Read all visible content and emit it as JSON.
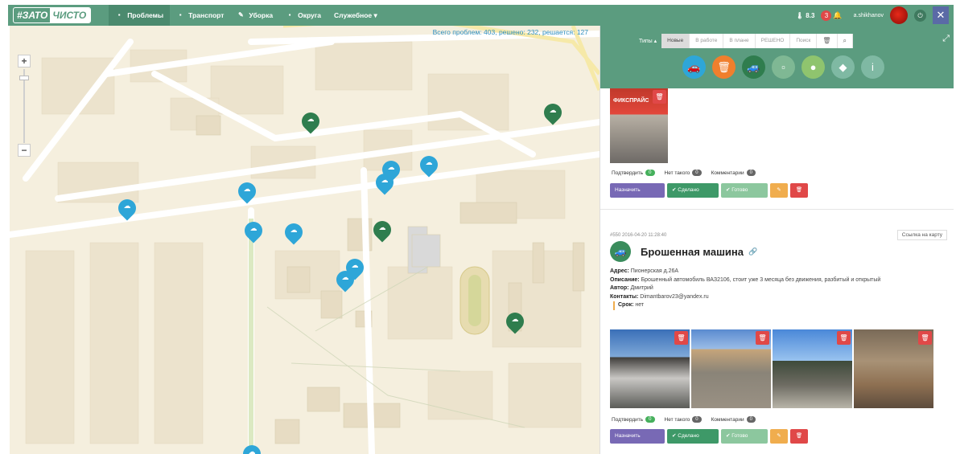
{
  "navbar": {
    "logo_left": "#ЗАТО",
    "logo_right": "ЧИСТО",
    "items": [
      {
        "label": "Проблемы",
        "icon": "list-icon",
        "glyph": "▪",
        "active": true
      },
      {
        "label": "Транспорт",
        "icon": "bus-icon",
        "glyph": "▪",
        "active": false
      },
      {
        "label": "Уборка",
        "icon": "broom-icon",
        "glyph": "✎",
        "active": false
      },
      {
        "label": "Округа",
        "icon": "district-icon",
        "glyph": "▪",
        "active": false
      },
      {
        "label": "Служебное ▾",
        "icon": "",
        "glyph": "",
        "active": false
      }
    ],
    "rating": "8.3 ",
    "notifications": "3",
    "username": "a.shikhanov"
  },
  "map": {
    "summary": "Всего проблем: 403, решено: 232, решается: 127",
    "zoom_in": "+",
    "zoom_out": "−",
    "markers": [
      {
        "kind": "green",
        "glyph": "☁"
      },
      {
        "kind": "green",
        "glyph": "☁"
      },
      {
        "kind": "blue",
        "glyph": "☁"
      },
      {
        "kind": "blue",
        "glyph": "☁"
      },
      {
        "kind": "blue",
        "glyph": "☁"
      },
      {
        "kind": "blue",
        "glyph": "☁"
      },
      {
        "kind": "blue",
        "glyph": "☁"
      },
      {
        "kind": "blue",
        "glyph": "☁"
      },
      {
        "kind": "blue",
        "glyph": "☁"
      },
      {
        "kind": "blue",
        "glyph": "☁"
      },
      {
        "kind": "green",
        "glyph": "☁"
      },
      {
        "kind": "blue",
        "glyph": "☁"
      },
      {
        "kind": "green",
        "glyph": "☁"
      },
      {
        "kind": "blue",
        "glyph": "☁"
      }
    ]
  },
  "panel": {
    "types_toggle": "Типы ▴",
    "tabs": [
      "Новые",
      "В работе",
      "В плане",
      "РЕШЕНО",
      "Поиск"
    ],
    "trash_glyph": "🗑",
    "search_glyph": "⌕",
    "expand_glyph": "⤢",
    "categories": [
      {
        "name": "car-icon",
        "glyph": "🚗",
        "color": "#2ea6d8"
      },
      {
        "name": "trash-icon",
        "glyph": "🗑",
        "color": "#f07f2d"
      },
      {
        "name": "abandoned-car-icon",
        "glyph": "🚙",
        "color": "#2f7d4e"
      },
      {
        "name": "bus-stop-icon",
        "glyph": "▫",
        "color": "#7fb894"
      },
      {
        "name": "tree-icon",
        "glyph": "●",
        "color": "#8fc46e"
      },
      {
        "name": "road-icon",
        "glyph": "◆",
        "color": "#7fb9a3"
      },
      {
        "name": "sign-icon",
        "glyph": "i",
        "color": "#7fb9a3"
      }
    ],
    "card1": {
      "shop_sign": "ФИКСПРАЙС",
      "confirm_label": "Подтвердить",
      "confirm_count": "0",
      "not_exist_label": "Нет такого",
      "not_exist_count": "0",
      "comments_label": "Комментарии",
      "comments_count": "0",
      "btn_assign": "Назначить",
      "btn_solved": "✔ Сделано",
      "btn_done": "✔ Готово",
      "btn_edit": "✎",
      "btn_delete": "🗑"
    },
    "post": {
      "meta": "#550 2016-04-20 11:28:40",
      "map_link": "Ссылка на карту",
      "title": "Брошенная машина",
      "link_glyph": "🔗",
      "address_label": "Адрес:",
      "address": "Пионерская д.26А",
      "description_label": "Описание:",
      "description": "Брошенный автомобиль ВАЗ2106, стоит уже 3 месяца без движения, разбитый и открытый",
      "author_label": "Автор:",
      "author": "Дмитрий",
      "contacts_label": "Контакты:",
      "contacts": "Dimantbarov23@yandex.ru",
      "deadline_label": "Срок:",
      "deadline": "нет"
    },
    "card2": {
      "confirm_label": "Подтвердить",
      "confirm_count": "0",
      "not_exist_label": "Нет такого",
      "not_exist_count": "0",
      "comments_label": "Комментарии",
      "comments_count": "0",
      "btn_assign": "Назначить",
      "btn_solved": "✔ Сделано",
      "btn_done": "✔ Готово",
      "btn_edit": "✎",
      "btn_delete": "🗑"
    }
  },
  "colors": {
    "brand": "#5b9c7f",
    "marker_blue": "#2ea6d8",
    "marker_green": "#2f7d4e",
    "delete": "#e04848"
  }
}
